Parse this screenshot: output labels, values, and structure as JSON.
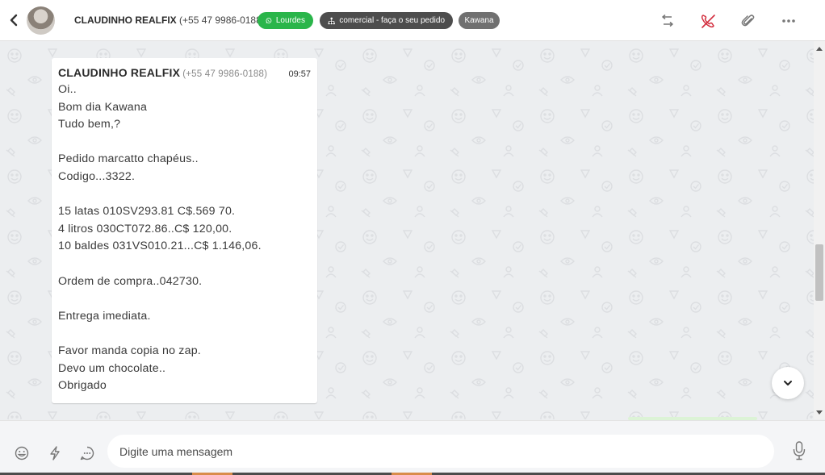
{
  "header": {
    "back_icon": "chevron-left-icon",
    "contact_name": "CLAUDINHO REALFIX",
    "contact_phone": "(+55 47 9986-0188)",
    "tags": {
      "agent": "Lourdes",
      "agent_icon": "whatsapp-icon",
      "department": "comercial - faça o seu pedido",
      "department_icon": "org-chart-icon",
      "user": "Kawana"
    },
    "actions": [
      "transfer-icon",
      "end-call-icon",
      "attach-icon",
      "more-icon"
    ],
    "accent_red": "#d32f3f"
  },
  "message": {
    "sender": "CLAUDINHO REALFIX",
    "phone": "(+55 47 9986-0188)",
    "time": "09:57",
    "lines": [
      "Oi..",
      "Bom dia Kawana",
      "Tudo bem,?",
      "",
      "Pedido marcatto chapéus..",
      "Codigo...3322.",
      "",
      "15 latas 010SV293.81 C$.569 70.",
      "4 litros 030CT072.86..C$ 120,00.",
      "10 baldes 031VS010.21...C$ 1.146,06.",
      "",
      "Ordem de compra..042730.",
      "",
      "Entrega imediata.",
      "",
      "Favor manda copia no zap.",
      "Devo um chocolate..",
      "Obrigado"
    ]
  },
  "composer": {
    "placeholder": "Digite uma mensagem",
    "left_icons": [
      "emoji-icon",
      "lightning-icon",
      "quick-reply-icon"
    ],
    "right_icon": "microphone-icon"
  },
  "colors": {
    "green_tag": "#2ab54a",
    "dark_tag": "#4d4d4d",
    "gray_tag": "#707070",
    "chat_bg": "#eceef0"
  }
}
